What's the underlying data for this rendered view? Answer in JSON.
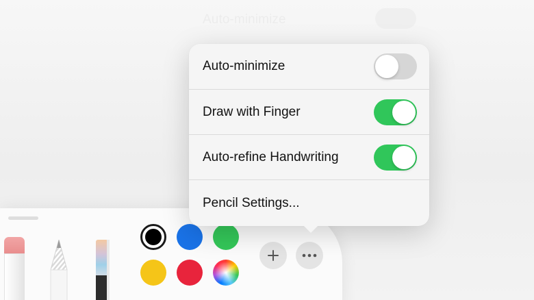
{
  "background": {
    "ghost_label": "Auto-minimize"
  },
  "menu": {
    "items": [
      {
        "label": "Auto-minimize",
        "toggle": false
      },
      {
        "label": "Draw with Finger",
        "toggle": true
      },
      {
        "label": "Auto-refine Handwriting",
        "toggle": true
      },
      {
        "label": "Pencil Settings..."
      }
    ]
  },
  "palette": {
    "tools": [
      {
        "name": "eraser-icon"
      },
      {
        "name": "pencil-icon"
      },
      {
        "name": "marker-icon"
      }
    ],
    "colors": [
      {
        "name": "black",
        "hex": "#000000",
        "selected": true
      },
      {
        "name": "blue",
        "hex": "#1a73e8",
        "selected": false
      },
      {
        "name": "green",
        "hex": "#34c759",
        "selected": false
      },
      {
        "name": "yellow",
        "hex": "#f5c518",
        "selected": false
      },
      {
        "name": "red",
        "hex": "#e8243c",
        "selected": false
      },
      {
        "name": "multicolor",
        "hex": "conic",
        "selected": false
      }
    ],
    "buttons": {
      "add_icon": "plus-icon",
      "more_icon": "ellipsis-icon"
    }
  },
  "accent": {
    "toggle_on": "#30c65a",
    "toggle_off": "#d6d6d6"
  }
}
